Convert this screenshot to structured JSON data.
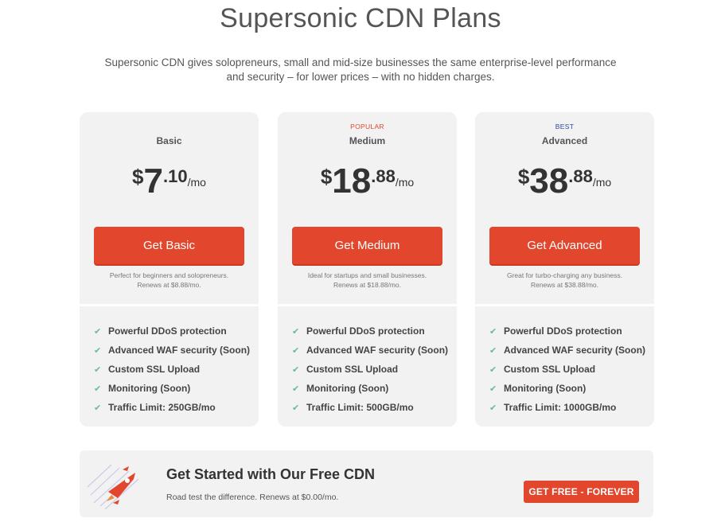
{
  "page": {
    "title": "Supersonic CDN Plans",
    "subtitle_line1": "Supersonic CDN gives solopreneurs, small and mid-size businesses the same enterprise-level performance",
    "subtitle_line2": "and security – for lower prices – with no hidden charges."
  },
  "colors": {
    "accent": "#e2472e",
    "popular_badge": "#e2472e",
    "best_badge": "#2d44a8",
    "check": "#6bb7a8",
    "card_bg": "#f2f2f2"
  },
  "plans": [
    {
      "badge": "",
      "name": "Basic",
      "currency": "$",
      "price_int": "7",
      "price_dec": ".10",
      "per": "/mo",
      "cta": "Get Basic",
      "note_line1": "Perfect for beginners and solopreneurs.",
      "note_line2": "Renews at $8.88/mo.",
      "features": [
        "Powerful DDoS protection",
        "Advanced WAF security (Soon)",
        "Custom SSL Upload",
        "Monitoring (Soon)",
        "Traffic Limit: 250GB/mo"
      ]
    },
    {
      "badge": "POPULAR",
      "name": "Medium",
      "currency": "$",
      "price_int": "18",
      "price_dec": ".88",
      "per": "/mo",
      "cta": "Get Medium",
      "note_line1": "Ideal for startups and small businesses.",
      "note_line2": "Renews at $18.88/mo.",
      "features": [
        "Powerful DDoS protection",
        "Advanced WAF security (Soon)",
        "Custom SSL Upload",
        "Monitoring (Soon)",
        "Traffic Limit: 500GB/mo"
      ]
    },
    {
      "badge": "BEST",
      "name": "Advanced",
      "currency": "$",
      "price_int": "38",
      "price_dec": ".88",
      "per": "/mo",
      "cta": "Get Advanced",
      "note_line1": "Great for turbo-charging any business.",
      "note_line2": "Renews at $38.88/mo.",
      "features": [
        "Powerful DDoS protection",
        "Advanced WAF security (Soon)",
        "Custom SSL Upload",
        "Monitoring (Soon)",
        "Traffic Limit: 1000GB/mo"
      ]
    }
  ],
  "check_glyph": "✔",
  "free": {
    "icon": "rocket-icon",
    "title": "Get Started with Our Free CDN",
    "note": "Road test the difference. Renews at $0.00/mo.",
    "cta": "GET FREE - FOREVER"
  }
}
